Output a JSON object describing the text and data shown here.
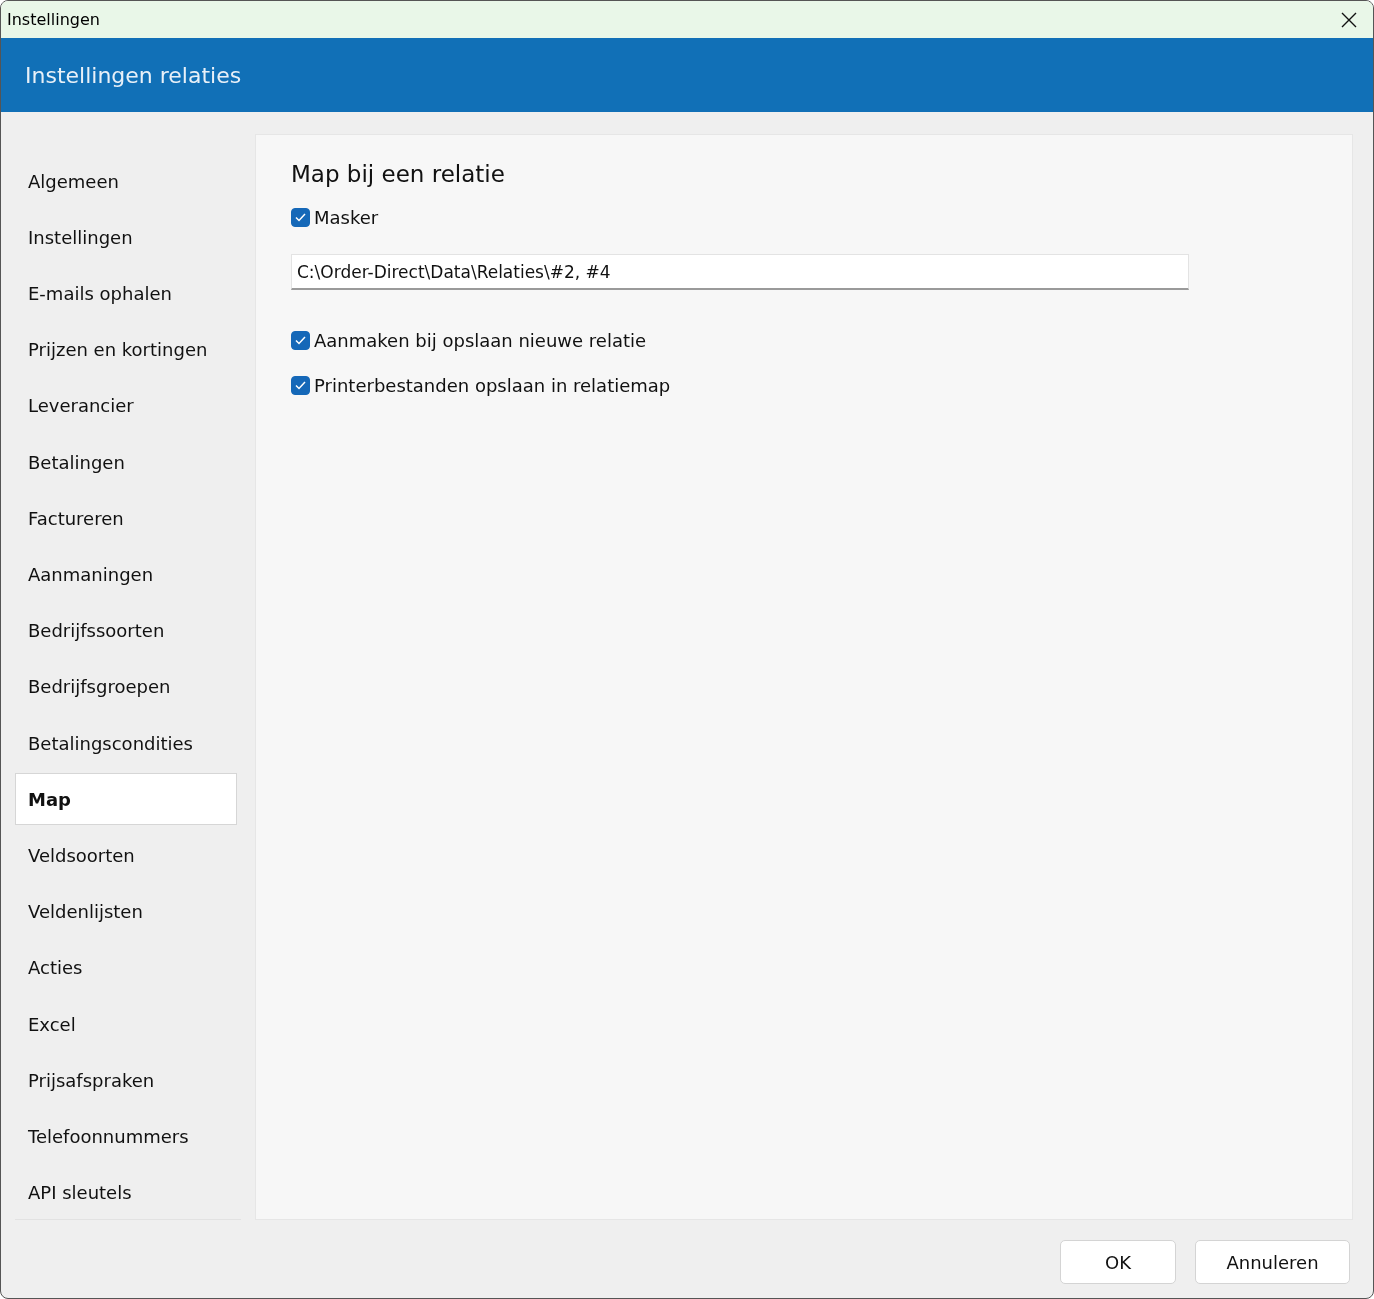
{
  "window": {
    "title": "Instellingen"
  },
  "header": {
    "title": "Instellingen relaties"
  },
  "sidebar": {
    "items": [
      {
        "label": "Algemeen",
        "selected": false
      },
      {
        "label": "Instellingen",
        "selected": false
      },
      {
        "label": "E-mails ophalen",
        "selected": false
      },
      {
        "label": "Prijzen en kortingen",
        "selected": false
      },
      {
        "label": "Leverancier",
        "selected": false
      },
      {
        "label": "Betalingen",
        "selected": false
      },
      {
        "label": "Factureren",
        "selected": false
      },
      {
        "label": "Aanmaningen",
        "selected": false
      },
      {
        "label": "Bedrijfssoorten",
        "selected": false
      },
      {
        "label": "Bedrijfsgroepen",
        "selected": false
      },
      {
        "label": "Betalingscondities",
        "selected": false
      },
      {
        "label": "Map",
        "selected": true
      },
      {
        "label": "Veldsoorten",
        "selected": false
      },
      {
        "label": "Veldenlijsten",
        "selected": false
      },
      {
        "label": "Acties",
        "selected": false
      },
      {
        "label": "Excel",
        "selected": false
      },
      {
        "label": "Prijsafspraken",
        "selected": false
      },
      {
        "label": "Telefoonnummers",
        "selected": false
      },
      {
        "label": "API sleutels",
        "selected": false
      }
    ]
  },
  "panel": {
    "title": "Map bij een relatie",
    "items": [
      {
        "kind": "checkbox",
        "label": "Masker",
        "checked": true
      },
      {
        "kind": "field",
        "value": "C:\\Order-Direct\\Data\\Relaties\\#2, #4"
      },
      {
        "kind": "checkbox",
        "label": "Aanmaken bij opslaan nieuwe relatie",
        "checked": true
      },
      {
        "kind": "checkbox",
        "label": "Printerbestanden opslaan in relatiemap",
        "checked": true
      }
    ]
  },
  "buttons": [
    "OK",
    "Annuleren"
  ]
}
